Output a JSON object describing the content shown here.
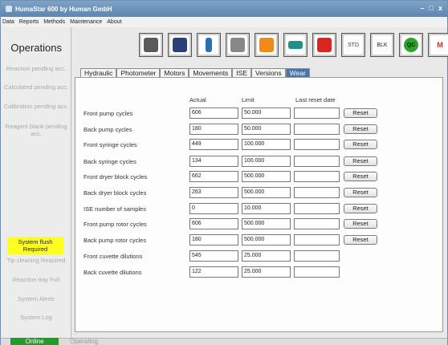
{
  "window": {
    "title": "HumaStar 600 by Human GmbH",
    "min": "–",
    "max": "□",
    "close": "x"
  },
  "menu": [
    "Data",
    "Reports",
    "Methods",
    "Maintenance",
    "About"
  ],
  "sidebar": {
    "title": "Operations",
    "items": [
      {
        "label": "Reaction pending acc.",
        "state": "disabled"
      },
      {
        "label": "Calculated pending acc.",
        "state": "disabled"
      },
      {
        "label": "Calibration pending acc.",
        "state": "disabled"
      },
      {
        "label": "Reagent blank pending acc.",
        "state": "disabled"
      },
      {
        "label": "System flush Required",
        "state": "alert"
      },
      {
        "label": "Tip cleaning Required",
        "state": "disabled"
      },
      {
        "label": "Reaction tray Full",
        "state": "disabled"
      },
      {
        "label": "System Alerts",
        "state": "disabled"
      },
      {
        "label": "System Log",
        "state": "disabled"
      }
    ]
  },
  "toolbar": [
    {
      "icon": "analyzer-icon",
      "label": ""
    },
    {
      "icon": "users-icon",
      "label": ""
    },
    {
      "icon": "reagent-bottle-icon",
      "label": ""
    },
    {
      "icon": "worklist-icon",
      "label": ""
    },
    {
      "icon": "sample-icon",
      "label": ""
    },
    {
      "icon": "tray-icon",
      "label": ""
    },
    {
      "icon": "rack-icon",
      "label": ""
    },
    {
      "icon": "std-icon",
      "label": "STD"
    },
    {
      "icon": "blk-icon",
      "label": "BLK"
    },
    {
      "icon": "qc-icon",
      "label": "QC"
    },
    {
      "icon": "report-icon",
      "label": "M"
    }
  ],
  "tabs": [
    {
      "label": "Hydraulic",
      "active": false
    },
    {
      "label": "Photometer",
      "active": false
    },
    {
      "label": "Motors",
      "active": false
    },
    {
      "label": "Movements",
      "active": false
    },
    {
      "label": "ISE",
      "active": false
    },
    {
      "label": "Versions",
      "active": false
    },
    {
      "label": "Wear",
      "active": true
    }
  ],
  "columns": {
    "actual": "Actual",
    "limit": "Limit",
    "last_reset": "Last reset date"
  },
  "rows": [
    {
      "label": "Front pump cycles",
      "actual": "606",
      "limit": "50.000",
      "last_reset": "",
      "reset": "Reset"
    },
    {
      "label": "Back pump cycles",
      "actual": "180",
      "limit": "50.000",
      "last_reset": "",
      "reset": "Reset"
    },
    {
      "label": "Front syringe cycles",
      "actual": "449",
      "limit": "100.000",
      "last_reset": "",
      "reset": "Reset"
    },
    {
      "label": "Back syringe cycles",
      "actual": "134",
      "limit": "100.000",
      "last_reset": "",
      "reset": "Reset"
    },
    {
      "label": "Front dryer block cycles",
      "actual": "662",
      "limit": "500.000",
      "last_reset": "",
      "reset": "Reset"
    },
    {
      "label": "Back dryer block cycles",
      "actual": "263",
      "limit": "500.000",
      "last_reset": "",
      "reset": "Reset"
    },
    {
      "label": "ISE number of samples",
      "actual": "0",
      "limit": "10.000",
      "last_reset": "",
      "reset": "Reset"
    },
    {
      "label": "Front pump rotor cycles",
      "actual": "606",
      "limit": "500.000",
      "last_reset": "",
      "reset": "Reset"
    },
    {
      "label": "Back pump rotor cycles",
      "actual": "180",
      "limit": "500.000",
      "last_reset": "",
      "reset": "Reset"
    },
    {
      "label": "Front cuvette dilutions",
      "actual": "545",
      "limit": "25.000",
      "last_reset": ""
    },
    {
      "label": "Back cuvette dilutions",
      "actual": "122",
      "limit": "25.000",
      "last_reset": ""
    }
  ],
  "status": {
    "online": "Online",
    "operating": "Operating"
  },
  "colors": {
    "alert": "#ffff22",
    "online": "#1f9d28",
    "active_tab": "#4b73a7",
    "desktop": "#9ebcd6"
  }
}
